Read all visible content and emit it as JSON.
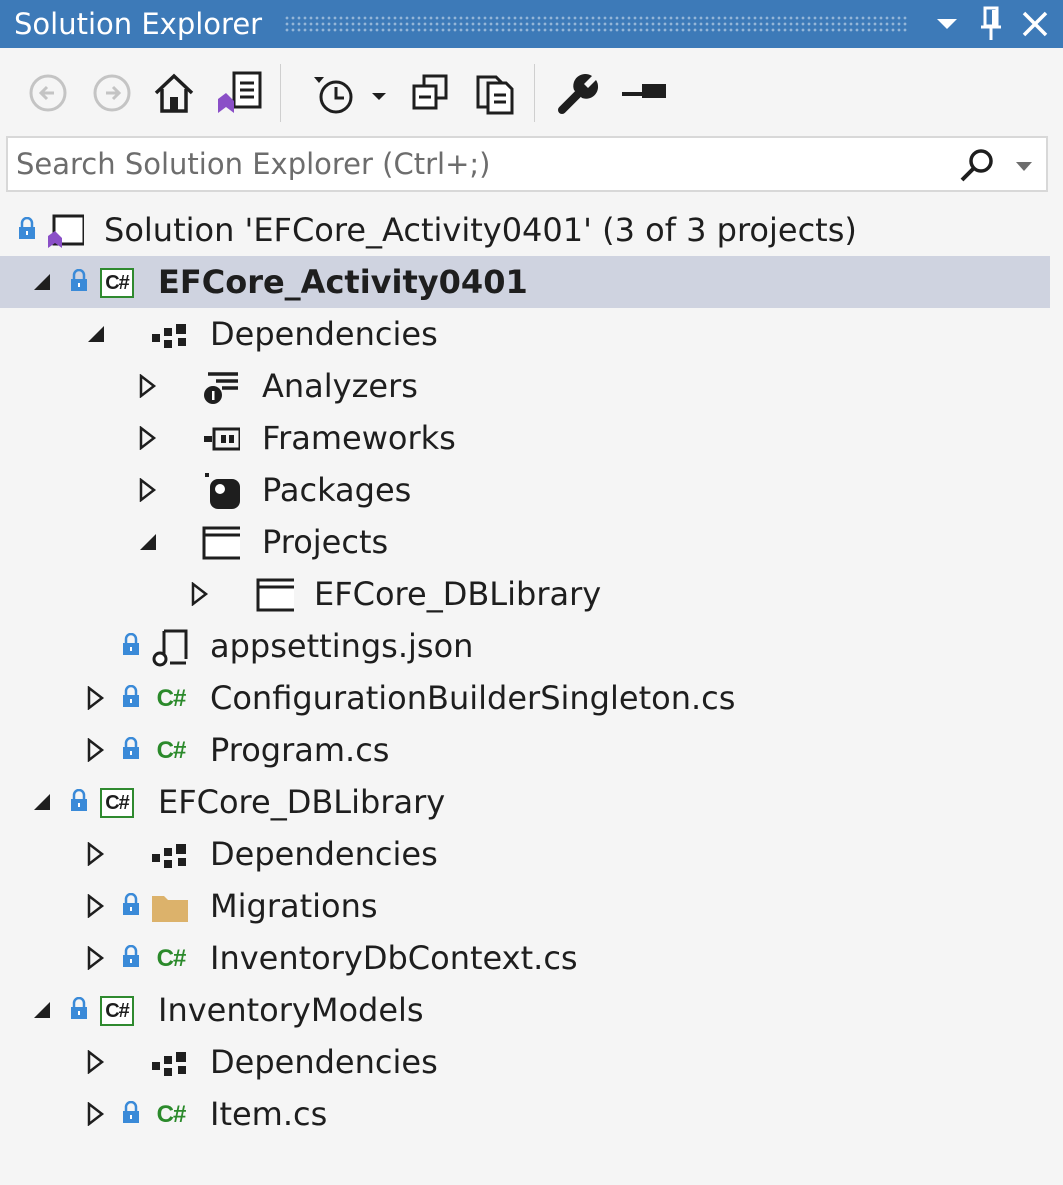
{
  "titlebar": {
    "title": "Solution Explorer",
    "buttons": [
      "dropdown-icon",
      "pin-icon",
      "close-icon"
    ]
  },
  "toolbar": {
    "buttons": [
      "back-icon",
      "forward-icon",
      "home-icon",
      "switch-views-icon",
      "pending-changes-filter-icon",
      "collapse-all-icon",
      "show-all-files-icon",
      "properties-icon",
      "preview-selected-icon"
    ]
  },
  "search": {
    "placeholder": "Search Solution Explorer (Ctrl+;)"
  },
  "colors": {
    "titlebar": "#3d7ab8",
    "selection": "#cfd3e0",
    "csharp_green": "#2b8a2b",
    "lock_blue": "#3a8ad8",
    "folder": "#dcb26b"
  },
  "tree": [
    {
      "label": "Solution 'EFCore_Activity0401' (3 of 3 projects)",
      "icon": "solution-icon",
      "expanded": null,
      "locked": true
    },
    {
      "label": "EFCore_Activity0401",
      "icon": "csharp-project-icon",
      "expanded": true,
      "locked": true,
      "selected": true,
      "bold": true
    },
    {
      "label": "Dependencies",
      "icon": "dependencies-icon",
      "expanded": true,
      "locked": false
    },
    {
      "label": "Analyzers",
      "icon": "analyzers-icon",
      "expanded": false,
      "locked": false
    },
    {
      "label": "Frameworks",
      "icon": "frameworks-icon",
      "expanded": false,
      "locked": false
    },
    {
      "label": "Packages",
      "icon": "packages-icon",
      "expanded": false,
      "locked": false
    },
    {
      "label": "Projects",
      "icon": "projects-icon",
      "expanded": true,
      "locked": false
    },
    {
      "label": "EFCore_DBLibrary",
      "icon": "project-reference-icon",
      "expanded": false,
      "locked": false
    },
    {
      "label": "appsettings.json",
      "icon": "json-file-icon",
      "expanded": null,
      "locked": true
    },
    {
      "label": "ConfigurationBuilderSingleton.cs",
      "icon": "csharp-file-icon",
      "expanded": false,
      "locked": true
    },
    {
      "label": "Program.cs",
      "icon": "csharp-file-icon",
      "expanded": false,
      "locked": true
    },
    {
      "label": "EFCore_DBLibrary",
      "icon": "csharp-project-icon",
      "expanded": true,
      "locked": true
    },
    {
      "label": "Dependencies",
      "icon": "dependencies-icon",
      "expanded": false,
      "locked": false
    },
    {
      "label": "Migrations",
      "icon": "folder-icon",
      "expanded": false,
      "locked": true
    },
    {
      "label": "InventoryDbContext.cs",
      "icon": "csharp-file-icon",
      "expanded": false,
      "locked": true
    },
    {
      "label": "InventoryModels",
      "icon": "csharp-project-icon",
      "expanded": true,
      "locked": true
    },
    {
      "label": "Dependencies",
      "icon": "dependencies-icon",
      "expanded": false,
      "locked": false
    },
    {
      "label": "Item.cs",
      "icon": "csharp-file-icon",
      "expanded": false,
      "locked": true
    }
  ]
}
